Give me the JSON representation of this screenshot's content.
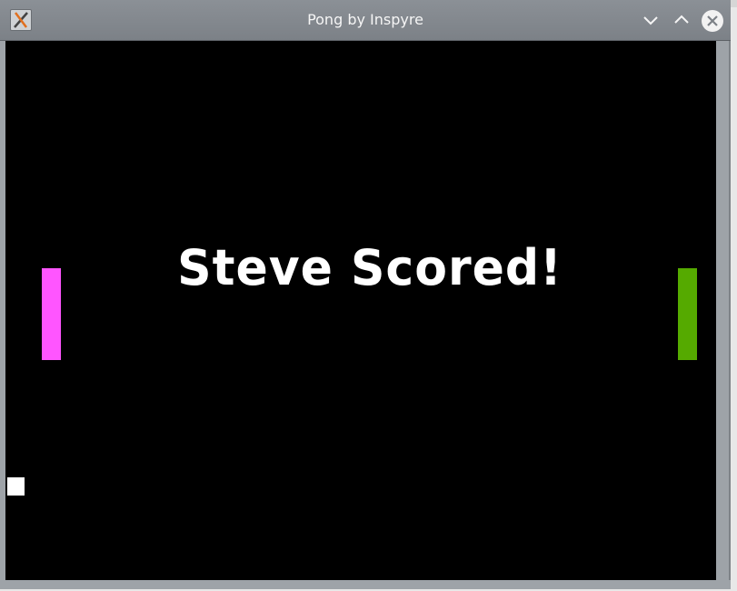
{
  "window": {
    "title": "Pong by Inspyre",
    "app_icon": "x-app-icon",
    "buttons": {
      "minimize": "chevron-down-icon",
      "maximize": "chevron-up-icon",
      "close": "close-icon"
    }
  },
  "game": {
    "message": "Steve Scored!",
    "background_color": "#000000",
    "left_paddle_color": "#ff55ff",
    "right_paddle_color": "#55aa00",
    "ball_color": "#ffffff"
  }
}
